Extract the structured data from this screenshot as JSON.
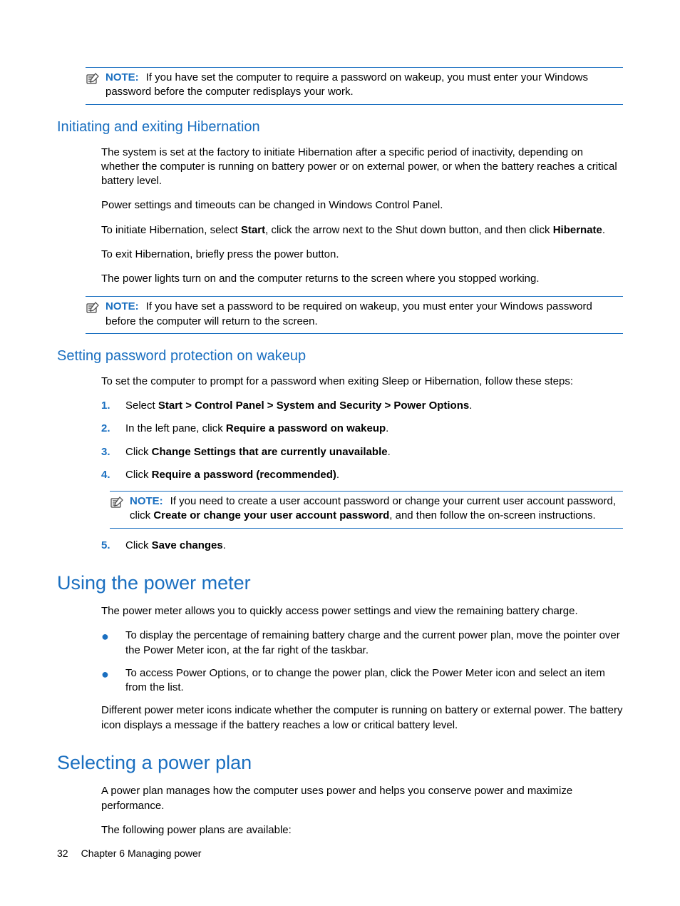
{
  "notes": {
    "label": "NOTE:",
    "top": "If you have set the computer to require a password on wakeup, you must enter your Windows password before the computer redisplays your work.",
    "hib": "If you have set a password to be required on wakeup, you must enter your Windows password before the computer will return to the screen.",
    "pw_pre": "If you need to create a user account password or change your current user account password, click ",
    "pw_bold": "Create or change your user account password",
    "pw_post": ", and then follow the on-screen instructions."
  },
  "hib": {
    "heading": "Initiating and exiting Hibernation",
    "p1": "The system is set at the factory to initiate Hibernation after a specific period of inactivity, depending on whether the computer is running on battery power or on external power, or when the battery reaches a critical battery level.",
    "p2": "Power settings and timeouts can be changed in Windows Control Panel.",
    "p3_pre": "To initiate Hibernation, select ",
    "p3_b1": "Start",
    "p3_mid": ", click the arrow next to the Shut down button, and then click ",
    "p3_b2": "Hibernate",
    "p3_post": ".",
    "p4": "To exit Hibernation, briefly press the power button.",
    "p5": "The power lights turn on and the computer returns to the screen where you stopped working."
  },
  "pw": {
    "heading": "Setting password protection on wakeup",
    "intro": "To set the computer to prompt for a password when exiting Sleep or Hibernation, follow these steps:",
    "s1_pre": "Select ",
    "s1_b": "Start > Control Panel > System and Security > Power Options",
    "s1_post": ".",
    "s2_pre": "In the left pane, click ",
    "s2_b": "Require a password on wakeup",
    "s2_post": ".",
    "s3_pre": "Click ",
    "s3_b": "Change Settings that are currently unavailable",
    "s3_post": ".",
    "s4_pre": "Click ",
    "s4_b": "Require a password (recommended)",
    "s4_post": ".",
    "s5_pre": "Click ",
    "s5_b": "Save changes",
    "s5_post": ".",
    "nums": {
      "n1": "1.",
      "n2": "2.",
      "n3": "3.",
      "n4": "4.",
      "n5": "5."
    }
  },
  "meter": {
    "heading": "Using the power meter",
    "p1": "The power meter allows you to quickly access power settings and view the remaining battery charge.",
    "b1": "To display the percentage of remaining battery charge and the current power plan, move the pointer over the Power Meter icon, at the far right of the taskbar.",
    "b2": "To access Power Options, or to change the power plan, click the Power Meter icon and select an item from the list.",
    "p2": "Different power meter icons indicate whether the computer is running on battery or external power. The battery icon displays a message if the battery reaches a low or critical battery level."
  },
  "plan": {
    "heading": "Selecting a power plan",
    "p1": "A power plan manages how the computer uses power and helps you conserve power and maximize performance.",
    "p2": "The following power plans are available:"
  },
  "footer": {
    "page": "32",
    "chapter": "Chapter 6   Managing power"
  },
  "bullet": "●"
}
